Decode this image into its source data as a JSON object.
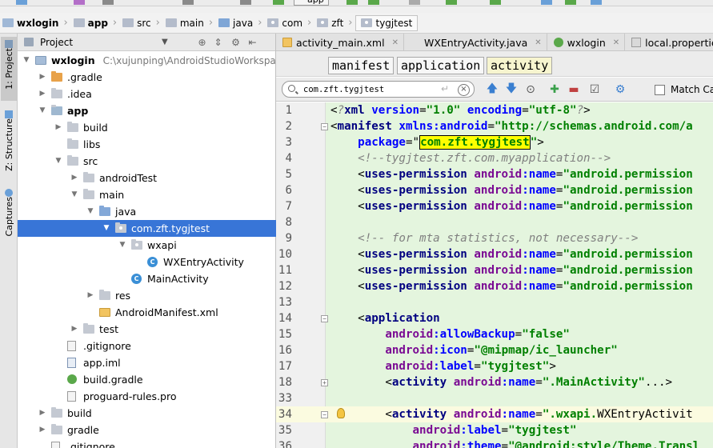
{
  "toolbar": {
    "run_config": "app"
  },
  "breadcrumb": [
    {
      "label": "wxlogin",
      "kind": "module",
      "bold": true
    },
    {
      "label": "app",
      "kind": "folder",
      "bold": true
    },
    {
      "label": "src",
      "kind": "folder"
    },
    {
      "label": "main",
      "kind": "folder"
    },
    {
      "label": "java",
      "kind": "folder-blue"
    },
    {
      "label": "com",
      "kind": "package"
    },
    {
      "label": "zft",
      "kind": "package"
    },
    {
      "label": "tygjtest",
      "kind": "package"
    }
  ],
  "side_tabs": {
    "project": "1: Project",
    "structure": "Z: Structure",
    "captures": "Captures"
  },
  "project_panel": {
    "title": "Project",
    "tree": [
      {
        "label": "wxlogin",
        "hint": "C:\\xujunping\\AndroidStudioWorkspace",
        "icon": "module",
        "depth": 0,
        "arrow": "down",
        "bold": true
      },
      {
        "label": ".gradle",
        "icon": "folder-orange",
        "depth": 1,
        "arrow": "right"
      },
      {
        "label": ".idea",
        "icon": "folder",
        "depth": 1,
        "arrow": "right"
      },
      {
        "label": "app",
        "icon": "folder-green",
        "depth": 1,
        "arrow": "down",
        "bold": true
      },
      {
        "label": "build",
        "icon": "folder",
        "depth": 2,
        "arrow": "right"
      },
      {
        "label": "libs",
        "icon": "folder",
        "depth": 2,
        "arrow": ""
      },
      {
        "label": "src",
        "icon": "folder",
        "depth": 2,
        "arrow": "down"
      },
      {
        "label": "androidTest",
        "icon": "folder",
        "depth": 3,
        "arrow": "right"
      },
      {
        "label": "main",
        "icon": "folder",
        "depth": 3,
        "arrow": "down"
      },
      {
        "label": "java",
        "icon": "folder-blue",
        "depth": 4,
        "arrow": "down"
      },
      {
        "label": "com.zft.tygjtest",
        "icon": "package",
        "depth": 5,
        "arrow": "down",
        "selected": true
      },
      {
        "label": "wxapi",
        "icon": "package",
        "depth": 6,
        "arrow": "down"
      },
      {
        "label": "WXEntryActivity",
        "icon": "class",
        "depth": 7,
        "arrow": ""
      },
      {
        "label": "MainActivity",
        "icon": "class",
        "depth": 6,
        "arrow": ""
      },
      {
        "label": "res",
        "icon": "folder",
        "depth": 4,
        "arrow": "right"
      },
      {
        "label": "AndroidManifest.xml",
        "icon": "xml",
        "depth": 4,
        "arrow": ""
      },
      {
        "label": "test",
        "icon": "folder",
        "depth": 3,
        "arrow": "right"
      },
      {
        "label": ".gitignore",
        "icon": "file",
        "depth": 2,
        "arrow": ""
      },
      {
        "label": "app.iml",
        "icon": "iml",
        "depth": 2,
        "arrow": ""
      },
      {
        "label": "build.gradle",
        "icon": "gradle",
        "depth": 2,
        "arrow": ""
      },
      {
        "label": "proguard-rules.pro",
        "icon": "file",
        "depth": 2,
        "arrow": ""
      },
      {
        "label": "build",
        "icon": "folder",
        "depth": 1,
        "arrow": "right"
      },
      {
        "label": "gradle",
        "icon": "folder",
        "depth": 1,
        "arrow": "right"
      },
      {
        "label": ".gitignore",
        "icon": "file",
        "depth": 1,
        "arrow": ""
      }
    ]
  },
  "editor_tabs": [
    {
      "label": "activity_main.xml",
      "icon": "xml",
      "active": false
    },
    {
      "label": "WXEntryActivity.java",
      "icon": "class",
      "active": false
    },
    {
      "label": "wxlogin",
      "icon": "wx",
      "active": false
    },
    {
      "label": "local.properties",
      "icon": "prop",
      "active": false
    }
  ],
  "xml_breadcrumb": [
    "manifest",
    "application",
    "activity"
  ],
  "search": {
    "value": "com.zft.tygjtest",
    "match_case": "Match Case"
  },
  "code": {
    "lines": [
      {
        "n": "1",
        "parts": [
          [
            "pl",
            "<"
          ],
          [
            "cmt",
            "?"
          ],
          [
            "tag",
            "xml "
          ],
          [
            "an",
            "version"
          ],
          [
            "pl",
            "="
          ],
          [
            "str",
            "\"1.0\""
          ],
          [
            "pl",
            " "
          ],
          [
            "an",
            "encoding"
          ],
          [
            "pl",
            "="
          ],
          [
            "str",
            "\"utf-8\""
          ],
          [
            "cmt",
            "?"
          ],
          [
            "pl",
            ">"
          ]
        ]
      },
      {
        "n": "2",
        "parts": [
          [
            "pl",
            "<"
          ],
          [
            "tag",
            "manifest "
          ],
          [
            "an",
            "xmlns:android"
          ],
          [
            "pl",
            "="
          ],
          [
            "str",
            "\"http://schemas.android.com/a"
          ]
        ]
      },
      {
        "n": "3",
        "parts": [
          [
            "pl",
            "    "
          ],
          [
            "an",
            "package"
          ],
          [
            "pl",
            "=\""
          ],
          [
            "hl",
            "com.zft.tygjtest"
          ],
          [
            "str",
            "\""
          ],
          [
            "pl",
            ">"
          ]
        ]
      },
      {
        "n": "4",
        "parts": [
          [
            "pl",
            "    "
          ],
          [
            "cmt",
            "<!--tygjtest.zft.com.myapplication-->"
          ]
        ]
      },
      {
        "n": "5",
        "parts": [
          [
            "pl",
            "    <"
          ],
          [
            "tag",
            "uses-permission "
          ],
          [
            "attr",
            "android"
          ],
          [
            "an",
            ":name"
          ],
          [
            "pl",
            "="
          ],
          [
            "str",
            "\"android.permission"
          ]
        ]
      },
      {
        "n": "6",
        "parts": [
          [
            "pl",
            "    <"
          ],
          [
            "tag",
            "uses-permission "
          ],
          [
            "attr",
            "android"
          ],
          [
            "an",
            ":name"
          ],
          [
            "pl",
            "="
          ],
          [
            "str",
            "\"android.permission"
          ]
        ]
      },
      {
        "n": "7",
        "parts": [
          [
            "pl",
            "    <"
          ],
          [
            "tag",
            "uses-permission "
          ],
          [
            "attr",
            "android"
          ],
          [
            "an",
            ":name"
          ],
          [
            "pl",
            "="
          ],
          [
            "str",
            "\"android.permission"
          ]
        ]
      },
      {
        "n": "8",
        "parts": []
      },
      {
        "n": "9",
        "parts": [
          [
            "pl",
            "    "
          ],
          [
            "cmt",
            "<!-- for mta statistics, not necessary-->"
          ]
        ]
      },
      {
        "n": "10",
        "parts": [
          [
            "pl",
            "    <"
          ],
          [
            "tag",
            "uses-permission "
          ],
          [
            "attr",
            "android"
          ],
          [
            "an",
            ":name"
          ],
          [
            "pl",
            "="
          ],
          [
            "str",
            "\"android.permission"
          ]
        ]
      },
      {
        "n": "11",
        "parts": [
          [
            "pl",
            "    <"
          ],
          [
            "tag",
            "uses-permission "
          ],
          [
            "attr",
            "android"
          ],
          [
            "an",
            ":name"
          ],
          [
            "pl",
            "="
          ],
          [
            "str",
            "\"android.permission"
          ]
        ]
      },
      {
        "n": "12",
        "parts": [
          [
            "pl",
            "    <"
          ],
          [
            "tag",
            "uses-permission "
          ],
          [
            "attr",
            "android"
          ],
          [
            "an",
            ":name"
          ],
          [
            "pl",
            "="
          ],
          [
            "str",
            "\"android.permission"
          ]
        ]
      },
      {
        "n": "13",
        "parts": []
      },
      {
        "n": "14",
        "parts": [
          [
            "pl",
            "    <"
          ],
          [
            "tag",
            "application"
          ]
        ]
      },
      {
        "n": "15",
        "parts": [
          [
            "pl",
            "        "
          ],
          [
            "attr",
            "android"
          ],
          [
            "an",
            ":allowBackup"
          ],
          [
            "pl",
            "="
          ],
          [
            "str",
            "\"false\""
          ]
        ]
      },
      {
        "n": "16",
        "parts": [
          [
            "pl",
            "        "
          ],
          [
            "attr",
            "android"
          ],
          [
            "an",
            ":icon"
          ],
          [
            "pl",
            "="
          ],
          [
            "str",
            "\"@mipmap/ic_launcher\""
          ]
        ]
      },
      {
        "n": "17",
        "parts": [
          [
            "pl",
            "        "
          ],
          [
            "attr",
            "android"
          ],
          [
            "an",
            ":label"
          ],
          [
            "pl",
            "="
          ],
          [
            "str",
            "\"tygjtest\""
          ],
          [
            "pl",
            ">"
          ]
        ]
      },
      {
        "n": "18",
        "parts": [
          [
            "pl",
            "        <"
          ],
          [
            "tag",
            "activity "
          ],
          [
            "attr",
            "android"
          ],
          [
            "an",
            ":name"
          ],
          [
            "pl",
            "="
          ],
          [
            "str",
            "\".MainActivity\""
          ],
          [
            "pl",
            "...>"
          ]
        ]
      },
      {
        "n": "33",
        "parts": []
      },
      {
        "n": "34",
        "parts": [
          [
            "pl",
            "        <"
          ],
          [
            "tag",
            "activity "
          ],
          [
            "attr",
            "android"
          ],
          [
            "an",
            ":name"
          ],
          [
            "pl",
            "="
          ],
          [
            "str",
            "\".wxapi."
          ],
          [
            "pl",
            "WXEntryActivit"
          ]
        ]
      },
      {
        "n": "35",
        "parts": [
          [
            "pl",
            "            "
          ],
          [
            "attr",
            "android"
          ],
          [
            "an",
            ":label"
          ],
          [
            "pl",
            "="
          ],
          [
            "str",
            "\"tygjtest\""
          ]
        ]
      },
      {
        "n": "36",
        "parts": [
          [
            "pl",
            "            "
          ],
          [
            "attr",
            "android"
          ],
          [
            "an",
            ":theme"
          ],
          [
            "pl",
            "="
          ],
          [
            "str",
            "\"@android:style/Theme.Transl"
          ]
        ]
      }
    ]
  }
}
